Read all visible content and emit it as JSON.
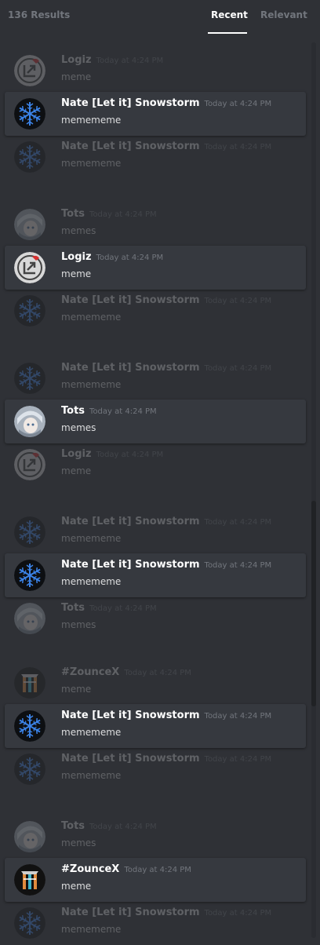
{
  "header": {
    "results_count": "136 Results",
    "tabs": [
      {
        "label": "Recent",
        "selected": true
      },
      {
        "label": "Relevant",
        "selected": false
      }
    ]
  },
  "colors": {
    "background": "#2f3136",
    "card": "#36393f",
    "muted": "#72767d",
    "text": "#dcddde",
    "snowflake_blue": "#2e6ed6"
  },
  "messages": [
    {
      "author": "Logiz",
      "timestamp": "Today at 4:24 PM",
      "content": "meme",
      "avatar": "logiz",
      "active": false
    },
    {
      "author": "Nate [Let it] Snowstorm",
      "timestamp": "Today at 4:24 PM",
      "content": "memememe",
      "avatar": "snowflake",
      "active": true
    },
    {
      "author": "Nate [Let it] Snowstorm",
      "timestamp": "Today at 4:24 PM",
      "content": "memememe",
      "avatar": "snowflake",
      "active": false
    },
    {
      "author": "Tots",
      "timestamp": "Today at 4:24 PM",
      "content": "memes",
      "avatar": "tots",
      "active": false
    },
    {
      "author": "Logiz",
      "timestamp": "Today at 4:24 PM",
      "content": "meme",
      "avatar": "logiz",
      "active": true
    },
    {
      "author": "Nate [Let it] Snowstorm",
      "timestamp": "Today at 4:24 PM",
      "content": "memememe",
      "avatar": "snowflake",
      "active": false
    },
    {
      "author": "Nate [Let it] Snowstorm",
      "timestamp": "Today at 4:24 PM",
      "content": "memememe",
      "avatar": "snowflake",
      "active": false
    },
    {
      "author": "Tots",
      "timestamp": "Today at 4:24 PM",
      "content": "memes",
      "avatar": "tots",
      "active": true
    },
    {
      "author": "Logiz",
      "timestamp": "Today at 4:24 PM",
      "content": "meme",
      "avatar": "logiz",
      "active": false
    },
    {
      "author": "Nate [Let it] Snowstorm",
      "timestamp": "Today at 4:24 PM",
      "content": "memememe",
      "avatar": "snowflake",
      "active": false
    },
    {
      "author": "Nate [Let it] Snowstorm",
      "timestamp": "Today at 4:24 PM",
      "content": "memememe",
      "avatar": "snowflake",
      "active": true
    },
    {
      "author": "Tots",
      "timestamp": "Today at 4:24 PM",
      "content": "memes",
      "avatar": "tots",
      "active": false
    },
    {
      "author": "#ZounceX",
      "timestamp": "Today at 4:24 PM",
      "content": "meme",
      "avatar": "zouncex",
      "active": false
    },
    {
      "author": "Nate [Let it] Snowstorm",
      "timestamp": "Today at 4:24 PM",
      "content": "memememe",
      "avatar": "snowflake",
      "active": true
    },
    {
      "author": "Nate [Let it] Snowstorm",
      "timestamp": "Today at 4:24 PM",
      "content": "memememe",
      "avatar": "snowflake",
      "active": false
    },
    {
      "author": "Tots",
      "timestamp": "Today at 4:24 PM",
      "content": "memes",
      "avatar": "tots",
      "active": false
    },
    {
      "author": "#ZounceX",
      "timestamp": "Today at 4:24 PM",
      "content": "meme",
      "avatar": "zouncex",
      "active": true
    },
    {
      "author": "Nate [Let it] Snowstorm",
      "timestamp": "Today at 4:24 PM",
      "content": "memememe",
      "avatar": "snowflake",
      "active": false
    }
  ]
}
